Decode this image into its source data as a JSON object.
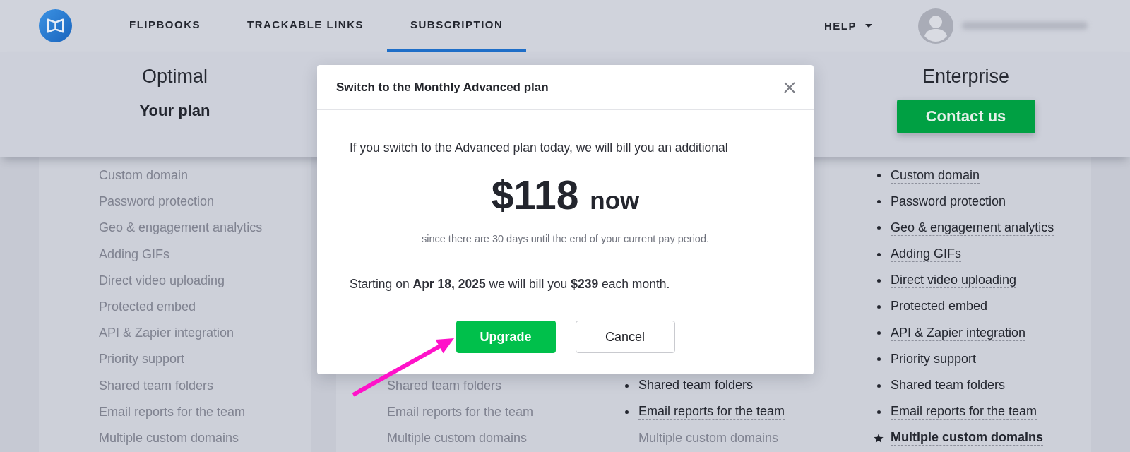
{
  "nav": {
    "items": [
      {
        "label": "FLIPBOOKS",
        "selected": false
      },
      {
        "label": "TRACKABLE LINKS",
        "selected": false
      },
      {
        "label": "SUBSCRIPTION",
        "selected": true
      }
    ],
    "help": "HELP"
  },
  "plans": [
    {
      "name": "Optimal",
      "current_label": "Your plan",
      "features": [
        {
          "label": "Custom domain",
          "included": false,
          "dotted": false,
          "featured": false
        },
        {
          "label": "Password protection",
          "included": false,
          "dotted": false,
          "featured": false
        },
        {
          "label": "Geo & engagement analytics",
          "included": false,
          "dotted": false,
          "featured": false
        },
        {
          "label": "Adding GIFs",
          "included": false,
          "dotted": false,
          "featured": false
        },
        {
          "label": "Direct video uploading",
          "included": false,
          "dotted": false,
          "featured": false
        },
        {
          "label": "Protected embed",
          "included": false,
          "dotted": false,
          "featured": false
        },
        {
          "label": "API & Zapier integration",
          "included": false,
          "dotted": false,
          "featured": false
        },
        {
          "label": "Priority support",
          "included": false,
          "dotted": false,
          "featured": false
        },
        {
          "label": "Shared team folders",
          "included": false,
          "dotted": false,
          "featured": false
        },
        {
          "label": "Email reports for the team",
          "included": false,
          "dotted": false,
          "featured": false
        },
        {
          "label": "Multiple custom domains",
          "included": false,
          "dotted": false,
          "featured": false
        }
      ]
    },
    {
      "features": [
        {
          "label": "Shared team folders",
          "included": false,
          "dotted": false,
          "featured": false
        },
        {
          "label": "Email reports for the team",
          "included": false,
          "dotted": false,
          "featured": false
        },
        {
          "label": "Multiple custom domains",
          "included": false,
          "dotted": false,
          "featured": false
        }
      ]
    },
    {
      "features": [
        {
          "label": "Shared team folders",
          "included": true,
          "dotted": true,
          "featured": false
        },
        {
          "label": "Email reports for the team",
          "included": true,
          "dotted": true,
          "featured": false
        },
        {
          "label": "Multiple custom domains",
          "included": false,
          "dotted": false,
          "featured": false
        }
      ]
    },
    {
      "name": "Enterprise",
      "button": "Contact us",
      "features": [
        {
          "label": "Custom domain",
          "included": true,
          "dotted": true,
          "featured": false
        },
        {
          "label": "Password protection",
          "included": true,
          "dotted": false,
          "featured": false
        },
        {
          "label": "Geo & engagement analytics",
          "included": true,
          "dotted": true,
          "featured": false
        },
        {
          "label": "Adding GIFs",
          "included": true,
          "dotted": true,
          "featured": false
        },
        {
          "label": "Direct video uploading",
          "included": true,
          "dotted": true,
          "featured": false
        },
        {
          "label": "Protected embed",
          "included": true,
          "dotted": true,
          "featured": false
        },
        {
          "label": "API & Zapier integration",
          "included": true,
          "dotted": true,
          "featured": false
        },
        {
          "label": "Priority support",
          "included": true,
          "dotted": false,
          "featured": false
        },
        {
          "label": "Shared team folders",
          "included": true,
          "dotted": true,
          "featured": false
        },
        {
          "label": "Email reports for the team",
          "included": true,
          "dotted": true,
          "featured": false
        },
        {
          "label": "Multiple custom domains",
          "included": true,
          "dotted": true,
          "featured": true
        }
      ]
    }
  ],
  "modal": {
    "title": "Switch to the Monthly Advanced plan",
    "intro": "If you switch to the Advanced plan today, we will bill you an additional",
    "amount": "$118",
    "amount_unit": "now",
    "note": "since there are 30 days until the end of your current pay period.",
    "schedule": "Starting on **Apr 18, 2025** we will bill you **$239** each month.",
    "buttons": [
      {
        "label": "Upgrade",
        "kind": "primary"
      },
      {
        "label": "Cancel",
        "kind": "secondary"
      }
    ]
  }
}
